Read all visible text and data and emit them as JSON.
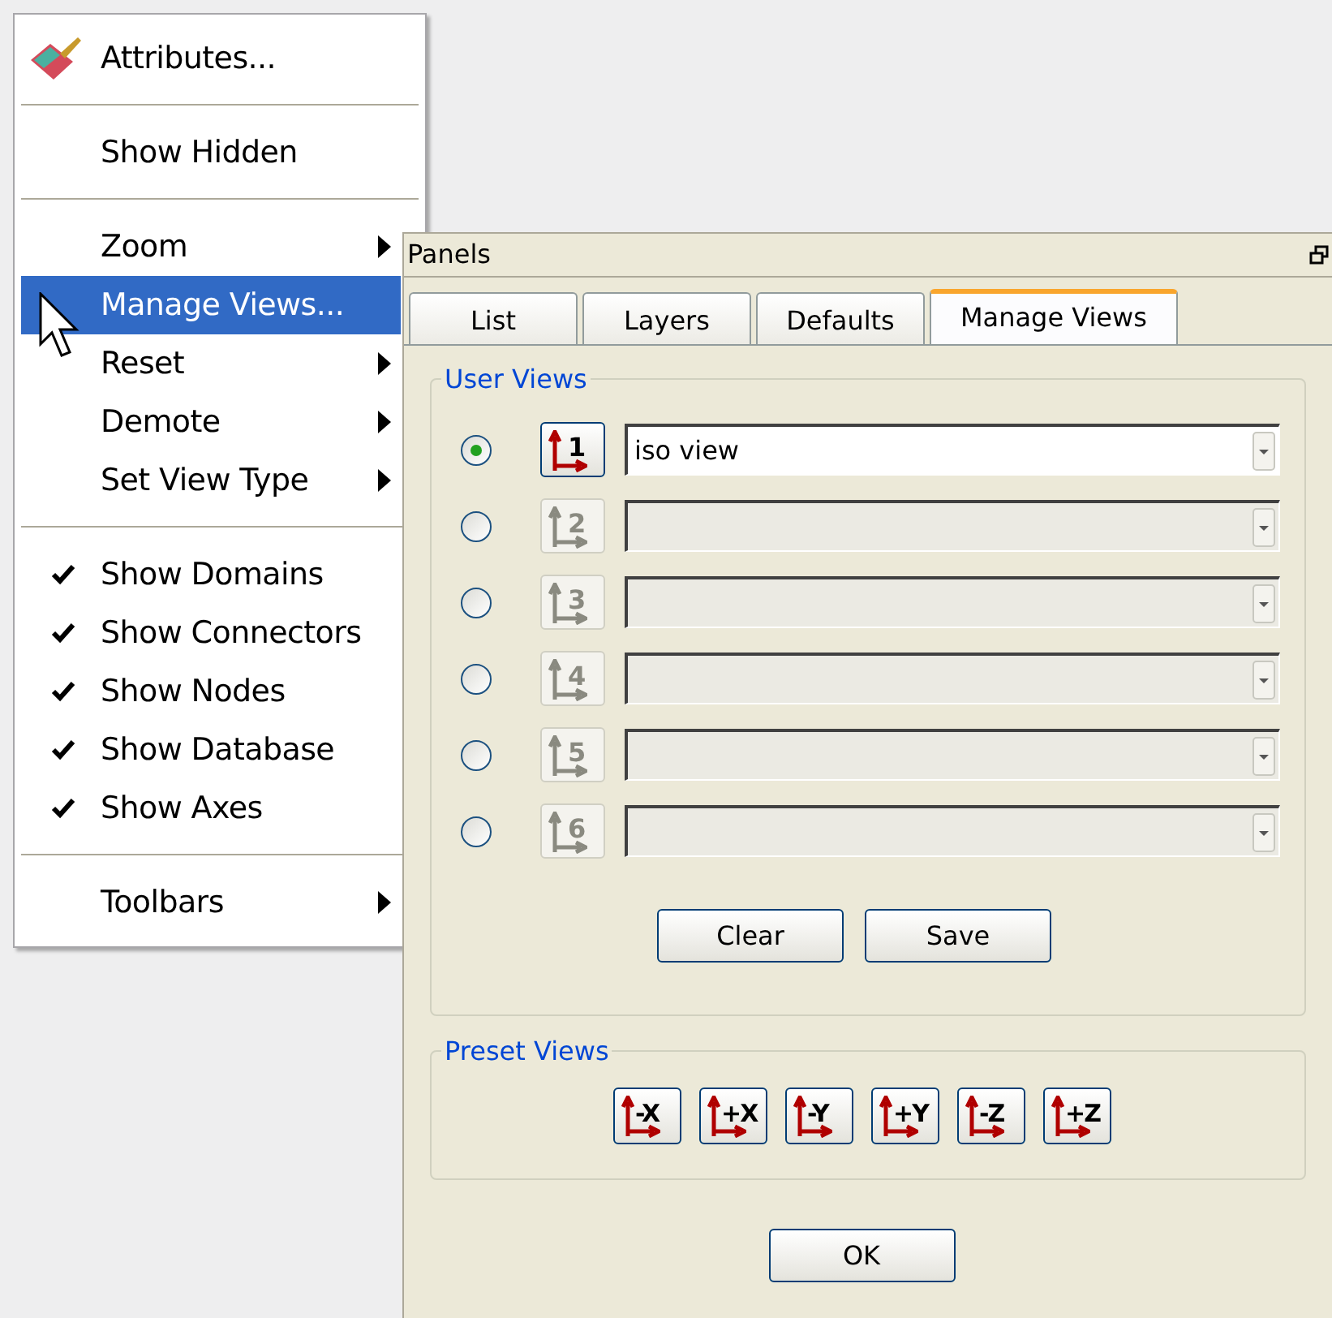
{
  "menu": {
    "groups": [
      [
        {
          "kind": "icon",
          "label": "Attributes...",
          "selected": false
        }
      ],
      [
        {
          "kind": "plain",
          "label": "Show Hidden",
          "selected": false
        }
      ],
      [
        {
          "kind": "submenu",
          "label": "Zoom",
          "selected": false
        },
        {
          "kind": "plain",
          "label": "Manage Views...",
          "selected": true
        },
        {
          "kind": "submenu",
          "label": "Reset",
          "selected": false
        },
        {
          "kind": "submenu",
          "label": "Demote",
          "selected": false
        },
        {
          "kind": "submenu",
          "label": "Set View Type",
          "selected": false
        }
      ],
      [
        {
          "kind": "check",
          "label": "Show Domains",
          "checked": true,
          "selected": false
        },
        {
          "kind": "check",
          "label": "Show Connectors",
          "checked": true,
          "selected": false
        },
        {
          "kind": "check",
          "label": "Show Nodes",
          "checked": true,
          "selected": false
        },
        {
          "kind": "check",
          "label": "Show Database",
          "checked": true,
          "selected": false
        },
        {
          "kind": "check",
          "label": "Show Axes",
          "checked": true,
          "selected": false
        }
      ],
      [
        {
          "kind": "submenu",
          "label": "Toolbars",
          "selected": false
        }
      ]
    ]
  },
  "panel": {
    "title": "Panels",
    "tabs": [
      {
        "label": "List",
        "selected": false
      },
      {
        "label": "Layers",
        "selected": false
      },
      {
        "label": "Defaults",
        "selected": false
      },
      {
        "label": "Manage Views",
        "selected": true
      }
    ],
    "user_views": {
      "title": "User Views",
      "rows": [
        {
          "number": "1",
          "value": "iso view",
          "selected": true,
          "disabled": false
        },
        {
          "number": "2",
          "selected": false,
          "disabled": true
        },
        {
          "number": "3",
          "selected": false,
          "disabled": true
        },
        {
          "number": "4",
          "selected": false,
          "disabled": true
        },
        {
          "number": "5",
          "selected": false,
          "disabled": true
        },
        {
          "number": "6",
          "selected": false,
          "disabled": true
        }
      ],
      "buttons": [
        "Clear",
        "Save"
      ]
    },
    "preset_views": {
      "title": "Preset Views",
      "buttons": [
        "-X",
        "+X",
        "-Y",
        "+Y",
        "-Z",
        "+Z"
      ]
    },
    "ok": "OK"
  }
}
